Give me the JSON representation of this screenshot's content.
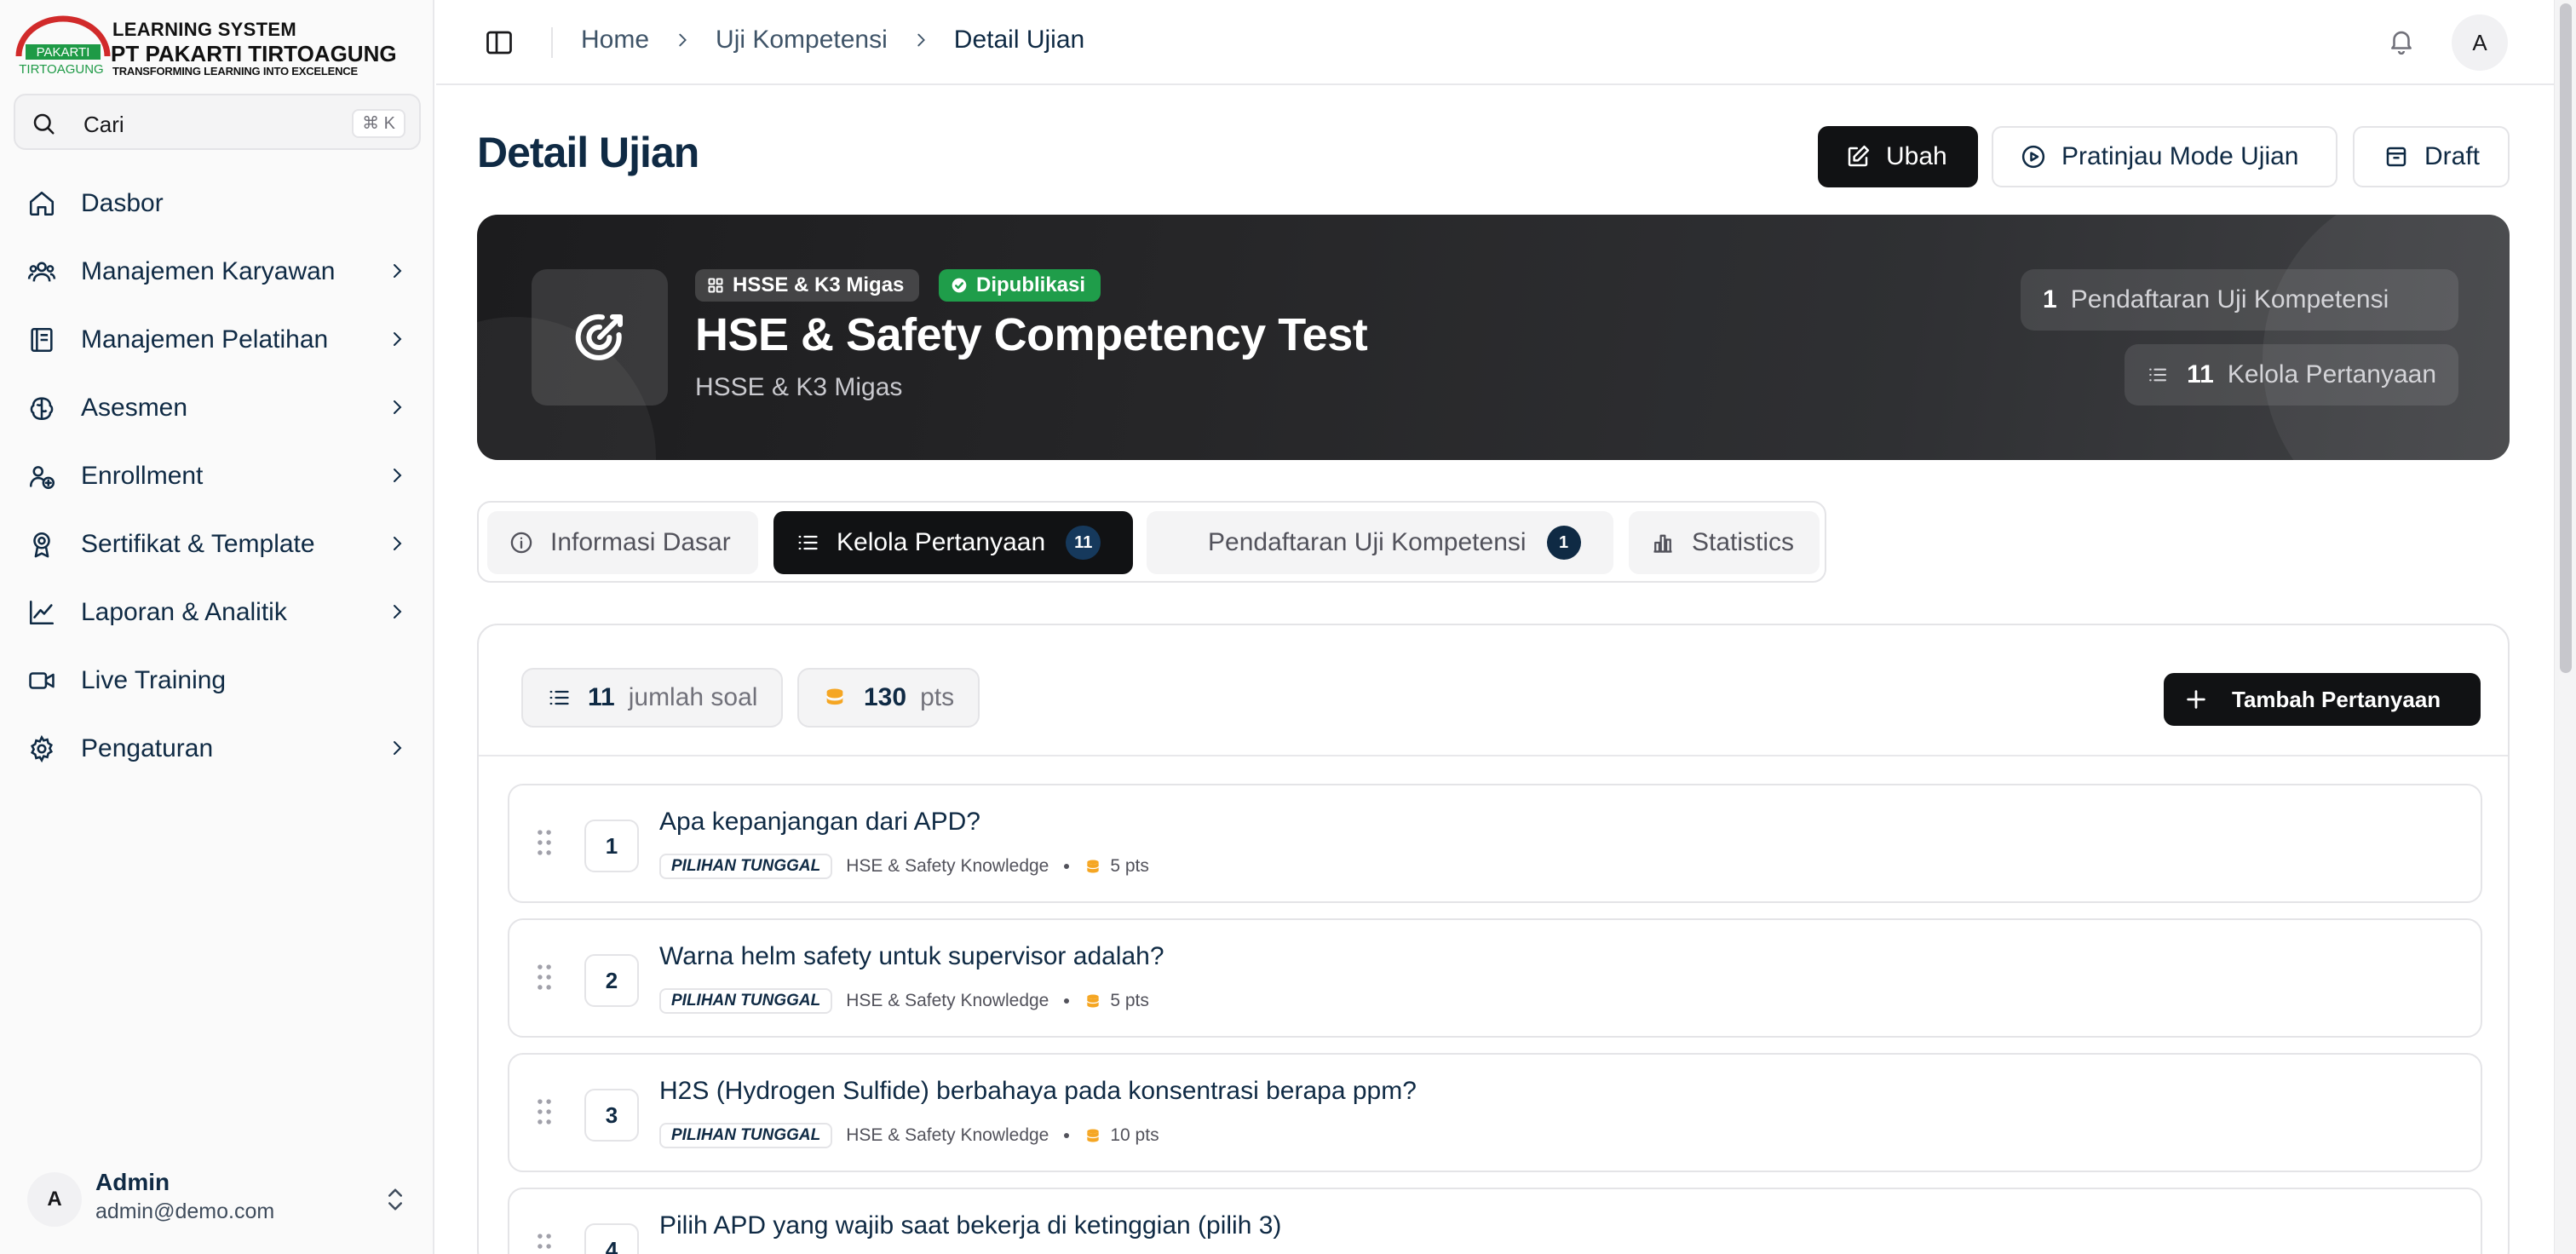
{
  "brand": {
    "line1": "LEARNING SYSTEM",
    "line2": "PT PAKARTI TIRTOAGUNG",
    "line3": "TRANSFORMING LEARNING INTO EXCELENCE",
    "mark_top": "PAKARTI",
    "mark_bottom": "TIRTOAGUNG",
    "colors": {
      "red": "#d12a2a",
      "green": "#1e9a46"
    }
  },
  "search": {
    "placeholder": "Cari",
    "shortcut": "⌘ K"
  },
  "sidebar": {
    "items": [
      {
        "label": "Dasbor",
        "icon": "home-icon",
        "has_chevron": false
      },
      {
        "label": "Manajemen Karyawan",
        "icon": "users-icon",
        "has_chevron": true
      },
      {
        "label": "Manajemen Pelatihan",
        "icon": "book-icon",
        "has_chevron": true
      },
      {
        "label": "Asesmen",
        "icon": "brain-icon",
        "has_chevron": true
      },
      {
        "label": "Enrollment",
        "icon": "user-plus-icon",
        "has_chevron": true
      },
      {
        "label": "Sertifikat & Template",
        "icon": "award-icon",
        "has_chevron": true
      },
      {
        "label": "Laporan & Analitik",
        "icon": "trend-icon",
        "has_chevron": true
      },
      {
        "label": "Live Training",
        "icon": "video-icon",
        "has_chevron": false
      },
      {
        "label": "Pengaturan",
        "icon": "gear-icon",
        "has_chevron": true
      }
    ]
  },
  "user": {
    "initial": "A",
    "name": "Admin",
    "email": "admin@demo.com"
  },
  "topbar": {
    "breadcrumbs": [
      "Home",
      "Uji Kompetensi",
      "Detail Ujian"
    ],
    "avatar_initial": "A"
  },
  "page": {
    "title": "Detail Ujian",
    "actions": {
      "edit": "Ubah",
      "preview": "Pratinjau Mode Ujian",
      "draft": "Draft"
    }
  },
  "hero": {
    "category_chip": "HSSE & K3 Migas",
    "status_chip": "Dipublikasi",
    "title": "HSE & Safety Competency Test",
    "subtitle": "HSSE & K3 Migas",
    "stat_enrollments": {
      "count": "1",
      "label": "Pendaftaran Uji Kompetensi"
    },
    "stat_questions": {
      "count": "11",
      "label": "Kelola Pertanyaan"
    },
    "colors": {
      "published": "#1f9d4a"
    }
  },
  "tabs": [
    {
      "label": "Informasi Dasar",
      "badge": null,
      "active": false
    },
    {
      "label": "Kelola Pertanyaan",
      "badge": "11",
      "active": true
    },
    {
      "label": "Pendaftaran Uji Kompetensi",
      "badge": "1",
      "active": false
    },
    {
      "label": "Statistics",
      "badge": null,
      "active": false
    }
  ],
  "questions_panel": {
    "question_count": "11",
    "question_count_label": "jumlah soal",
    "total_points": "130",
    "total_points_label": "pts",
    "add_button": "Tambah Pertanyaan",
    "items": [
      {
        "number": "1",
        "title": "Apa kepanjangan dari APD?",
        "type": "PILIHAN TUNGGAL",
        "category": "HSE & Safety Knowledge",
        "points": "5 pts"
      },
      {
        "number": "2",
        "title": "Warna helm safety untuk supervisor adalah?",
        "type": "PILIHAN TUNGGAL",
        "category": "HSE & Safety Knowledge",
        "points": "5 pts"
      },
      {
        "number": "3",
        "title": "H2S (Hydrogen Sulfide) berbahaya pada konsentrasi berapa ppm?",
        "type": "PILIHAN TUNGGAL",
        "category": "HSE & Safety Knowledge",
        "points": "10 pts"
      },
      {
        "number": "4",
        "title": "Pilih APD yang wajib saat bekerja di ketinggian (pilih 3)",
        "type": "",
        "category": "",
        "points": ""
      }
    ]
  },
  "colors": {
    "navy": "#0f2a44",
    "dark": "#111214",
    "coin": "#f5a623"
  }
}
